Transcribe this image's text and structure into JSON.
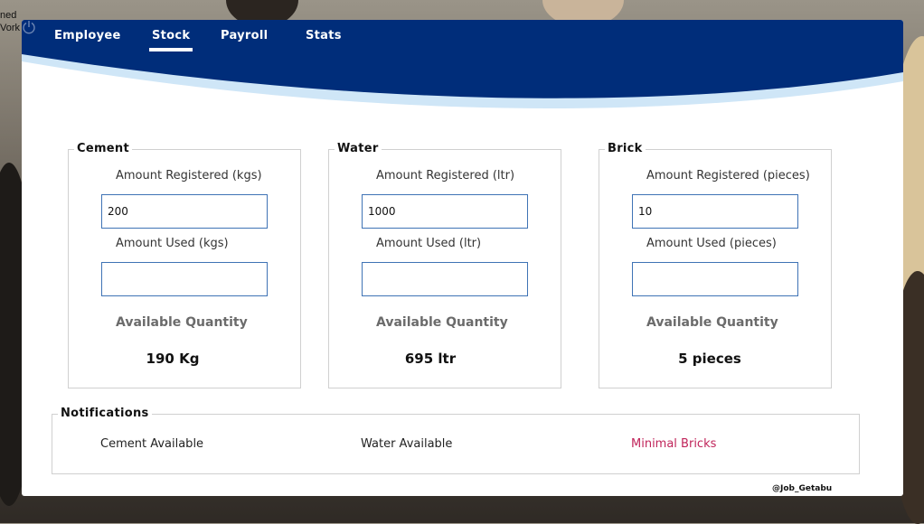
{
  "desktop": {
    "edge_text_line1": "ned",
    "edge_text_line2": "Vork"
  },
  "nav": {
    "items": [
      "Employee",
      "Stock",
      "Payroll",
      "Stats"
    ],
    "active": "Stock"
  },
  "colors": {
    "header_blue": "#002d7a",
    "accent_light_blue": "#cfe6f7",
    "field_border": "#3f73b5",
    "warning": "#c0245a"
  },
  "stock": [
    {
      "title": "Cement",
      "registered_label": "Amount Registered (kgs)",
      "registered_value": "200",
      "used_label": "Amount Used (kgs)",
      "used_value": "",
      "available_label": "Available Quantity",
      "available_value": "190 Kg"
    },
    {
      "title": "Water",
      "registered_label": "Amount Registered (ltr)",
      "registered_value": "1000",
      "used_label": "Amount Used (ltr)",
      "used_value": "",
      "available_label": "Available Quantity",
      "available_value": "695 ltr"
    },
    {
      "title": "Brick",
      "registered_label": "Amount Registered (pieces)",
      "registered_value": "10",
      "used_label": "Amount Used (pieces)",
      "used_value": "",
      "available_label": "Available Quantity",
      "available_value": "5 pieces"
    }
  ],
  "notifications": {
    "title": "Notifications",
    "items": [
      "Cement Available",
      "Water Available",
      "Minimal Bricks"
    ]
  },
  "credit": "@Job_Getabu",
  "icons": {
    "power": "power-icon"
  }
}
